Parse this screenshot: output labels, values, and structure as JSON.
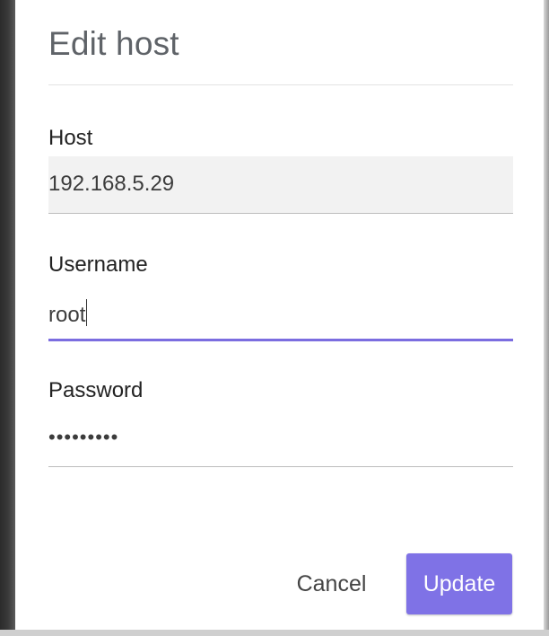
{
  "dialog": {
    "title": "Edit host"
  },
  "fields": {
    "host": {
      "label": "Host",
      "value": "192.168.5.29"
    },
    "username": {
      "label": "Username",
      "value": "root"
    },
    "password": {
      "label": "Password",
      "masked_value": "•••••••••"
    }
  },
  "actions": {
    "cancel_label": "Cancel",
    "update_label": "Update"
  },
  "colors": {
    "accent": "#7f72e6",
    "focus_underline": "#7b6de0"
  }
}
